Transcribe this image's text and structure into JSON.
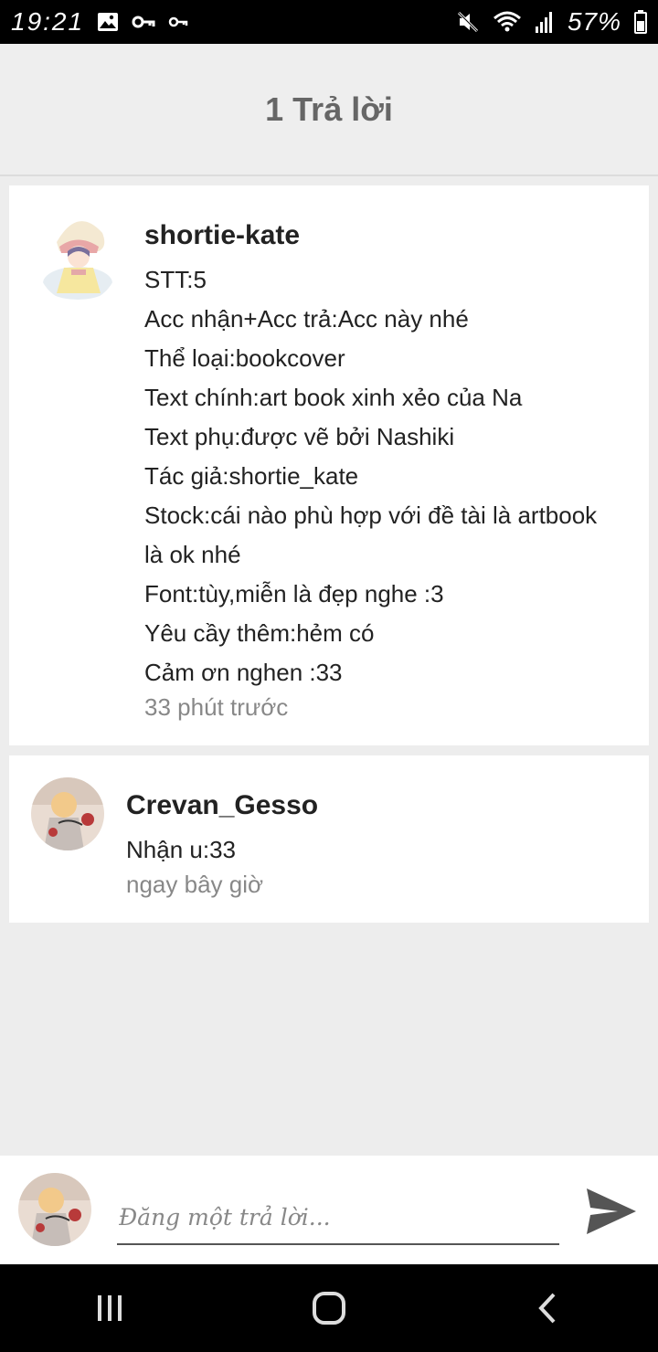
{
  "status_bar": {
    "time": "19:21",
    "battery_percent": "57%",
    "left_icons": [
      "image-icon",
      "key-icon",
      "vpn-key-icon"
    ],
    "right_icons": [
      "mute-icon",
      "wifi-icon",
      "signal-icon",
      "battery-icon"
    ]
  },
  "header": {
    "title": "1 Trả lời"
  },
  "comments": [
    {
      "author": "shortie-kate",
      "lines": [
        "STT:5",
        "Acc nhận+Acc trả:Acc này nhé",
        "Thể loại:bookcover",
        "Text chính:art book xinh xẻo của Na",
        "Text phụ:được vẽ bởi Nashiki",
        "Tác giả:shortie_kate",
        "Stock:cái nào phù hợp với đề tài là artbook",
        "là ok nhé",
        "Font:tùy,miễn là đẹp nghe :3",
        "Yêu cầy thêm:hẻm có",
        "Cảm ơn nghen :33"
      ],
      "time": "33 phút trước"
    },
    {
      "author": "Crevan_Gesso",
      "lines": [
        "Nhận u:33"
      ],
      "time": "ngay bây giờ"
    }
  ],
  "compose": {
    "placeholder": "Đăng một trả lời...",
    "value": ""
  },
  "nav": {
    "icons": [
      "recents-icon",
      "home-icon",
      "back-icon"
    ]
  },
  "colors": {
    "background": "#ededed",
    "header_title": "#666666",
    "timestamp": "#888888",
    "send_icon": "#555555"
  }
}
